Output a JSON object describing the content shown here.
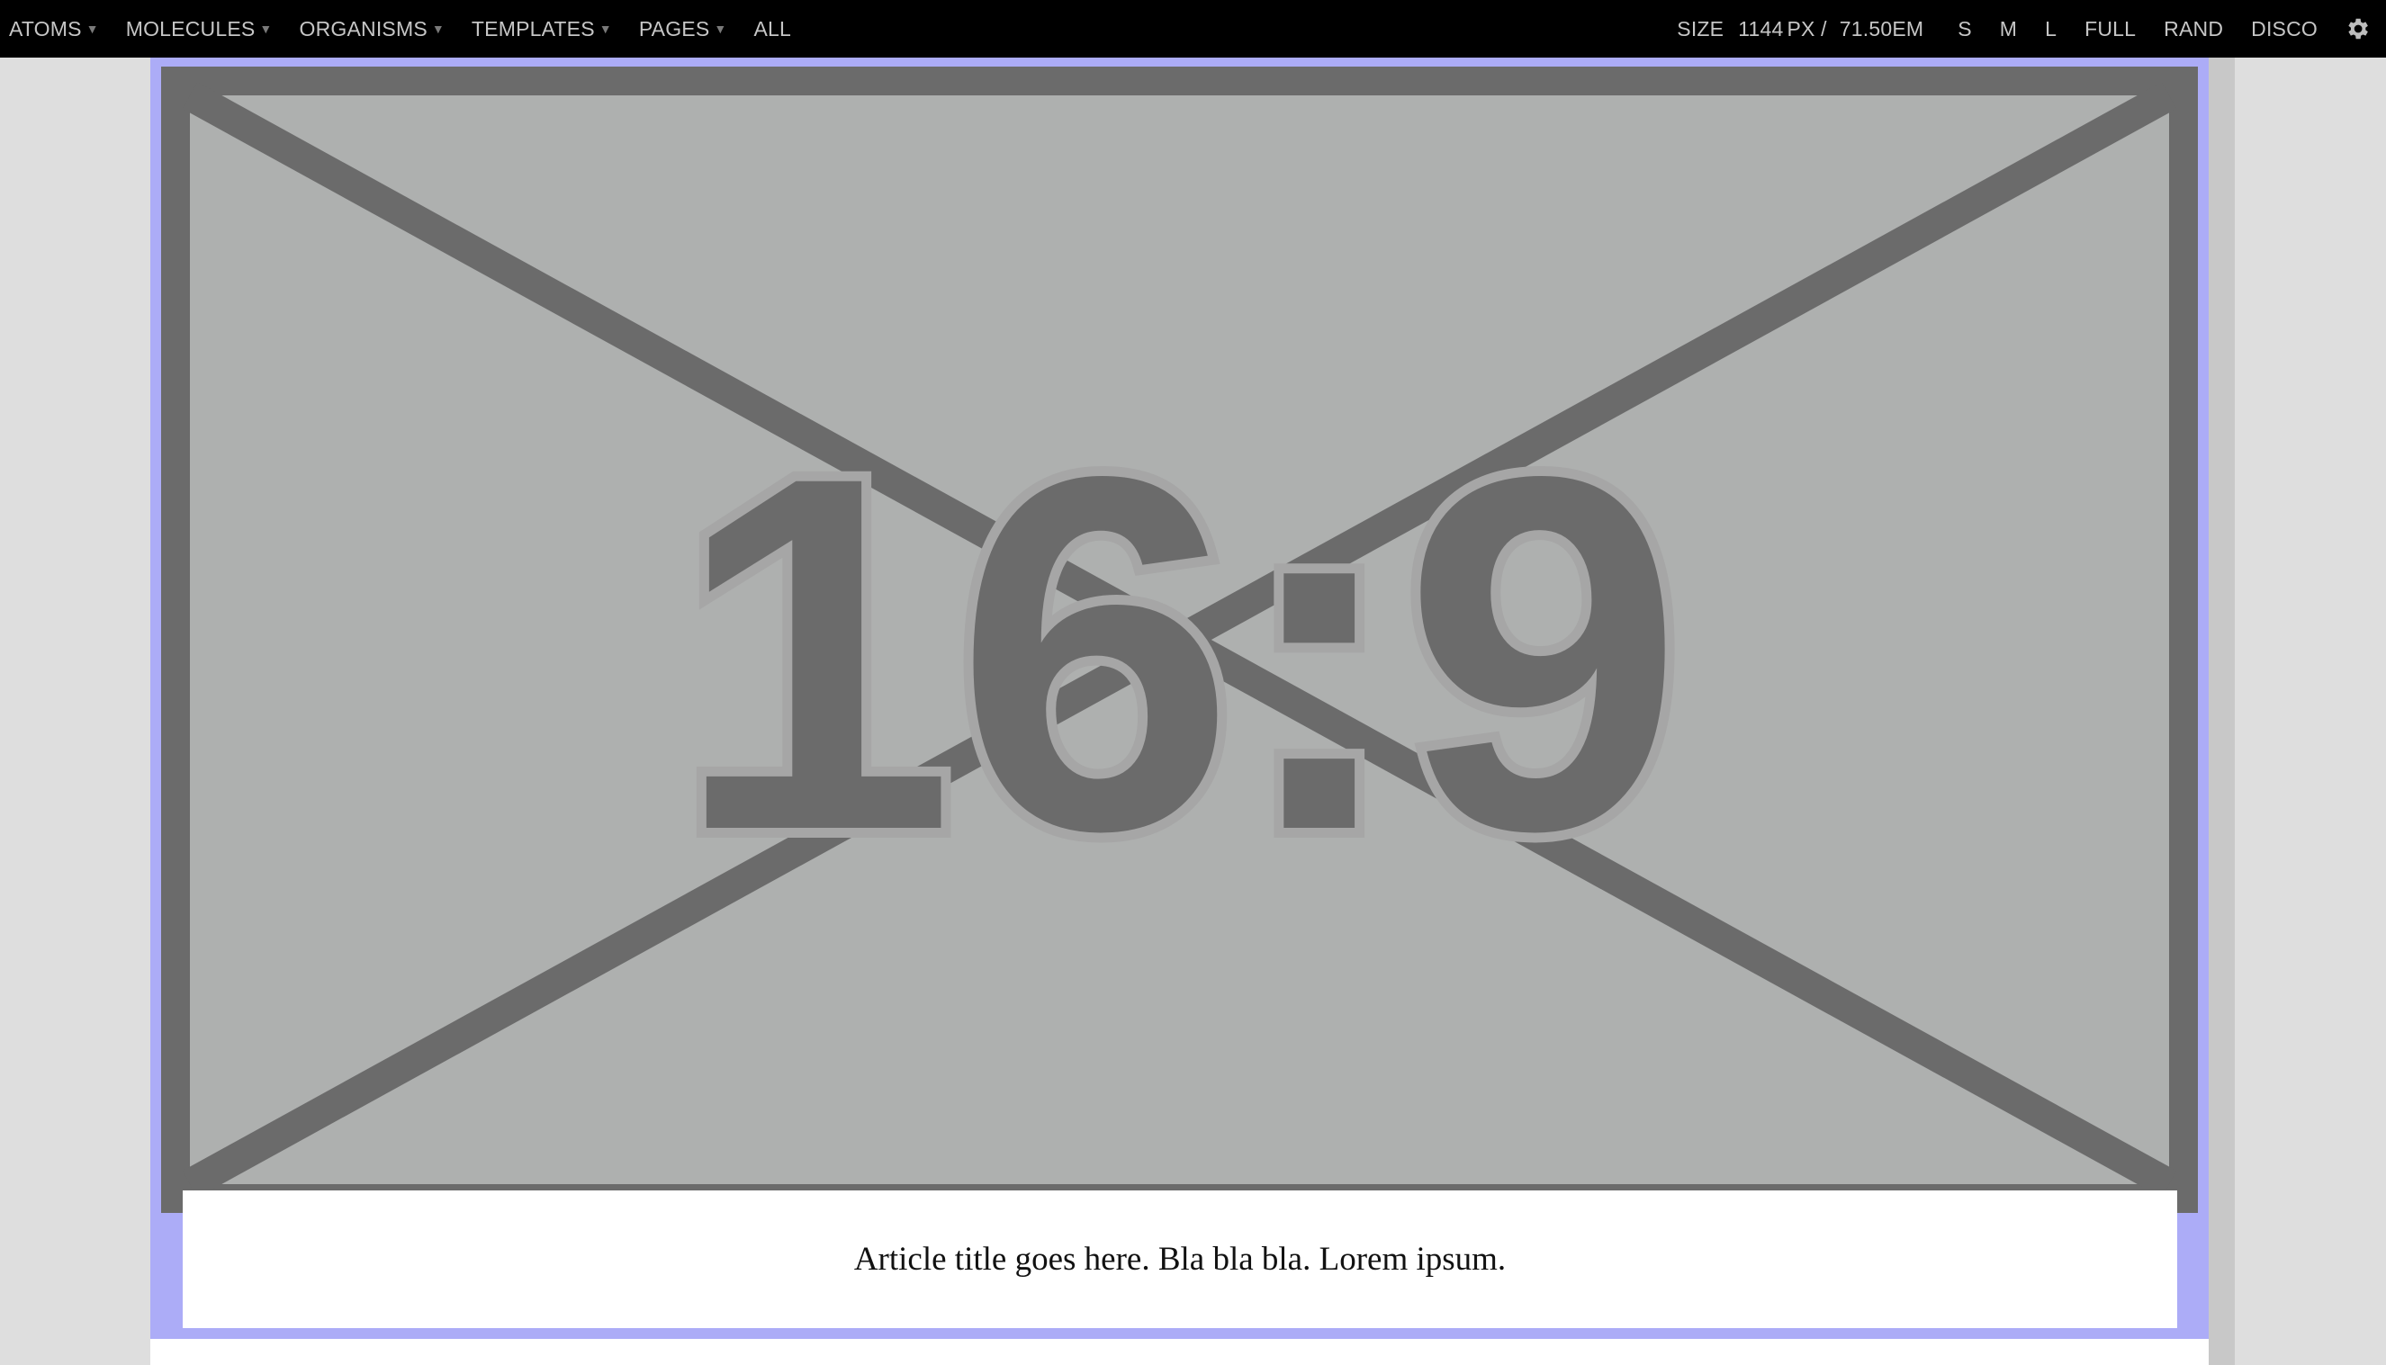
{
  "nav": {
    "left": [
      {
        "label": "ATOMS",
        "dropdown": true
      },
      {
        "label": "MOLECULES",
        "dropdown": true
      },
      {
        "label": "ORGANISMS",
        "dropdown": true
      },
      {
        "label": "TEMPLATES",
        "dropdown": true
      },
      {
        "label": "PAGES",
        "dropdown": true
      },
      {
        "label": "ALL",
        "dropdown": false
      }
    ],
    "size_label": "SIZE",
    "size_px": "1144",
    "size_px_unit": "PX /",
    "size_em": "71.50",
    "size_em_unit": "EM",
    "size_buttons": [
      "S",
      "M",
      "L",
      "FULL",
      "RAND",
      "DISCO"
    ],
    "settings_icon": "gear-icon"
  },
  "pattern": {
    "placeholder_text": "16:9",
    "caption": "Article title goes here. Bla bla bla. Lorem ipsum."
  },
  "colors": {
    "topbar_bg": "#000000",
    "highlight": "#acacf7",
    "placeholder_fill": "#aeb0af",
    "placeholder_stroke": "#6b6b6b",
    "page_bg": "#dedede"
  }
}
